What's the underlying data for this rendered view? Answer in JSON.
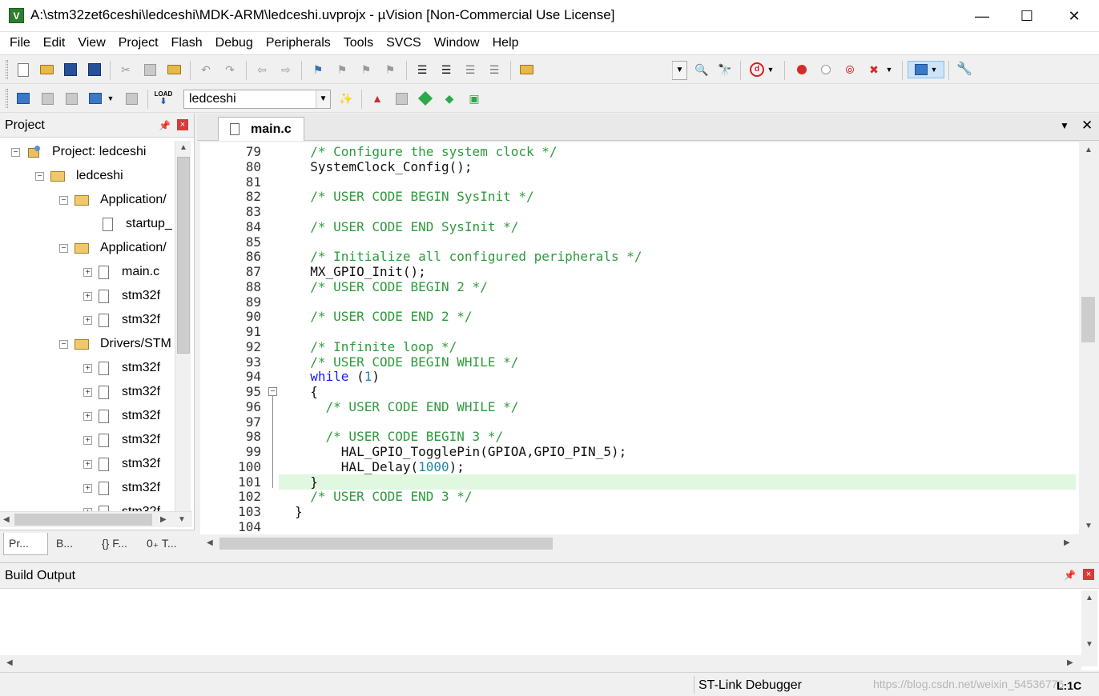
{
  "window": {
    "icon_text": "V",
    "title": "A:\\stm32zet6ceshi\\ledceshi\\MDK-ARM\\ledceshi.uvprojx - µVision  [Non-Commercial Use License]",
    "min_glyph": "—",
    "max_glyph": "☐",
    "close_glyph": "✕"
  },
  "menu": [
    "File",
    "Edit",
    "View",
    "Project",
    "Flash",
    "Debug",
    "Peripherals",
    "Tools",
    "SVCS",
    "Window",
    "Help"
  ],
  "toolbar2": {
    "target": "ledceshi",
    "load_label": "LOAD"
  },
  "project_panel": {
    "title": "Project",
    "pin_glyph": "📌",
    "close_glyph": "×",
    "tree": [
      {
        "label": "Project: ledceshi",
        "expander": "−"
      },
      {
        "label": "ledceshi",
        "expander": "−"
      },
      {
        "label": "Application/",
        "expander": "−"
      },
      {
        "label": "startup_",
        "expander": ""
      },
      {
        "label": "Application/",
        "expander": "−"
      },
      {
        "label": "main.c",
        "expander": "+"
      },
      {
        "label": "stm32f",
        "expander": "+"
      },
      {
        "label": "stm32f",
        "expander": "+"
      },
      {
        "label": "Drivers/STM",
        "expander": "−"
      },
      {
        "label": "stm32f",
        "expander": "+"
      },
      {
        "label": "stm32f",
        "expander": "+"
      },
      {
        "label": "stm32f",
        "expander": "+"
      },
      {
        "label": "stm32f",
        "expander": "+"
      },
      {
        "label": "stm32f",
        "expander": "+"
      },
      {
        "label": "stm32f",
        "expander": "+"
      },
      {
        "label": "stm32f",
        "expander": "+"
      }
    ],
    "tabs": [
      {
        "label": "Pr..."
      },
      {
        "label": "B..."
      },
      {
        "label": "{} F..."
      },
      {
        "label": "0₊ T..."
      }
    ]
  },
  "editor": {
    "tab_label": "main.c",
    "dropdown_glyph": "▼",
    "close_glyph": "✕",
    "lines": [
      {
        "n": "79",
        "parts": [
          {
            "t": "  /* Configure the system clock */",
            "c": "cmt"
          }
        ]
      },
      {
        "n": "80",
        "parts": [
          {
            "t": "  SystemClock_Config();",
            "c": "plain"
          }
        ]
      },
      {
        "n": "81",
        "parts": [
          {
            "t": "",
            "c": "plain"
          }
        ]
      },
      {
        "n": "82",
        "parts": [
          {
            "t": "  /* USER CODE BEGIN SysInit */",
            "c": "cmt"
          }
        ]
      },
      {
        "n": "83",
        "parts": [
          {
            "t": "",
            "c": "plain"
          }
        ]
      },
      {
        "n": "84",
        "parts": [
          {
            "t": "  /* USER CODE END SysInit */",
            "c": "cmt"
          }
        ]
      },
      {
        "n": "85",
        "parts": [
          {
            "t": "",
            "c": "plain"
          }
        ]
      },
      {
        "n": "86",
        "parts": [
          {
            "t": "  /* Initialize all configured peripherals */",
            "c": "cmt"
          }
        ]
      },
      {
        "n": "87",
        "parts": [
          {
            "t": "  MX_GPIO_Init();",
            "c": "plain"
          }
        ]
      },
      {
        "n": "88",
        "parts": [
          {
            "t": "  /* USER CODE BEGIN 2 */",
            "c": "cmt"
          }
        ]
      },
      {
        "n": "89",
        "parts": [
          {
            "t": "",
            "c": "plain"
          }
        ]
      },
      {
        "n": "90",
        "parts": [
          {
            "t": "  /* USER CODE END 2 */",
            "c": "cmt"
          }
        ]
      },
      {
        "n": "91",
        "parts": [
          {
            "t": "",
            "c": "plain"
          }
        ]
      },
      {
        "n": "92",
        "parts": [
          {
            "t": "  /* Infinite loop */",
            "c": "cmt"
          }
        ]
      },
      {
        "n": "93",
        "parts": [
          {
            "t": "  /* USER CODE BEGIN WHILE */",
            "c": "cmt"
          }
        ]
      },
      {
        "n": "94",
        "parts": [
          {
            "t": "  ",
            "c": "plain"
          },
          {
            "t": "while",
            "c": "kw"
          },
          {
            "t": " (",
            "c": "plain"
          },
          {
            "t": "1",
            "c": "num"
          },
          {
            "t": ")",
            "c": "plain"
          }
        ]
      },
      {
        "n": "95",
        "parts": [
          {
            "t": "  {",
            "c": "plain"
          }
        ]
      },
      {
        "n": "96",
        "parts": [
          {
            "t": "    /* USER CODE END WHILE */",
            "c": "cmt"
          }
        ]
      },
      {
        "n": "97",
        "parts": [
          {
            "t": "",
            "c": "plain"
          }
        ]
      },
      {
        "n": "98",
        "parts": [
          {
            "t": "    /* USER CODE BEGIN 3 */",
            "c": "cmt"
          }
        ]
      },
      {
        "n": "99",
        "parts": [
          {
            "t": "      HAL_GPIO_TogglePin(GPIOA,GPIO_PIN_5);",
            "c": "plain"
          }
        ]
      },
      {
        "n": "100",
        "parts": [
          {
            "t": "      HAL_Delay(",
            "c": "plain"
          },
          {
            "t": "1000",
            "c": "num"
          },
          {
            "t": ");",
            "c": "plain"
          }
        ]
      },
      {
        "n": "101",
        "parts": [
          {
            "t": "  }",
            "c": "plain"
          }
        ]
      },
      {
        "n": "102",
        "parts": [
          {
            "t": "  /* USER CODE END 3 */",
            "c": "cmt"
          }
        ]
      },
      {
        "n": "103",
        "parts": [
          {
            "t": "}",
            "c": "plain"
          }
        ]
      },
      {
        "n": "104",
        "parts": [
          {
            "t": "",
            "c": "plain"
          }
        ]
      }
    ],
    "highlight_line": "101"
  },
  "build_output": {
    "title": "Build Output",
    "pin_glyph": "📌",
    "close_glyph": "×"
  },
  "status": {
    "debugger": "ST-Link Debugger",
    "watermark": "https://blog.csdn.net/weixin_54536776",
    "position": "L:1C"
  },
  "colors": {
    "comment": "#2e9b3c",
    "keyword": "#1a1aff",
    "number": "#1f86a8",
    "highlight_line": "#dff8df"
  }
}
